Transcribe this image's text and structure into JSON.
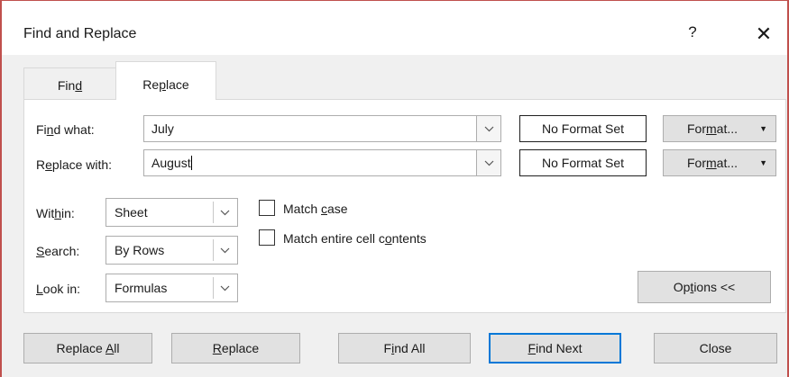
{
  "window": {
    "title": "Find and Replace",
    "help_label": "?",
    "close_label": "✕"
  },
  "tabs": {
    "find": {
      "pre": "Fin",
      "accel": "d",
      "post": ""
    },
    "replace": {
      "pre": "Re",
      "accel": "p",
      "post": "lace"
    },
    "active": "replace"
  },
  "find_what": {
    "label_pre": "Fi",
    "label_accel": "n",
    "label_post": "d what:",
    "value": "July",
    "format_status": "No Format Set",
    "format_btn_pre": "For",
    "format_btn_accel": "m",
    "format_btn_post": "at...",
    "format_arrow": "▼"
  },
  "replace_with": {
    "label_pre": "R",
    "label_accel": "e",
    "label_post": "place with:",
    "value": "August",
    "format_status": "No Format Set",
    "format_btn_pre": "For",
    "format_btn_accel": "m",
    "format_btn_post": "at...",
    "format_arrow": "▼"
  },
  "within": {
    "label_pre": "Wit",
    "label_accel": "h",
    "label_post": "in:",
    "value": "Sheet"
  },
  "search": {
    "label_pre": "",
    "label_accel": "S",
    "label_post": "earch:",
    "value": "By Rows"
  },
  "look_in": {
    "label_pre": "",
    "label_accel": "L",
    "label_post": "ook in:",
    "value": "Formulas"
  },
  "match_case": {
    "pre": "Match ",
    "accel": "c",
    "post": "ase",
    "checked": false
  },
  "match_entire": {
    "pre": "Match entire cell c",
    "accel": "o",
    "post": "ntents",
    "checked": false
  },
  "options_button": {
    "pre": "Op",
    "accel": "t",
    "post": "ions <<"
  },
  "buttons": {
    "replace_all": {
      "pre": "Replace ",
      "accel": "A",
      "post": "ll"
    },
    "replace": {
      "pre": "",
      "accel": "R",
      "post": "eplace"
    },
    "find_all": {
      "pre": "F",
      "accel": "i",
      "post": "nd All"
    },
    "find_next": {
      "pre": "",
      "accel": "F",
      "post": "ind Next"
    },
    "close": {
      "pre": "Close",
      "accel": "",
      "post": ""
    }
  },
  "colors": {
    "frame": "#c0504d",
    "client_bg": "#f0f0f0",
    "button_bg": "#e1e1e1",
    "default_button_border": "#0078d7"
  }
}
